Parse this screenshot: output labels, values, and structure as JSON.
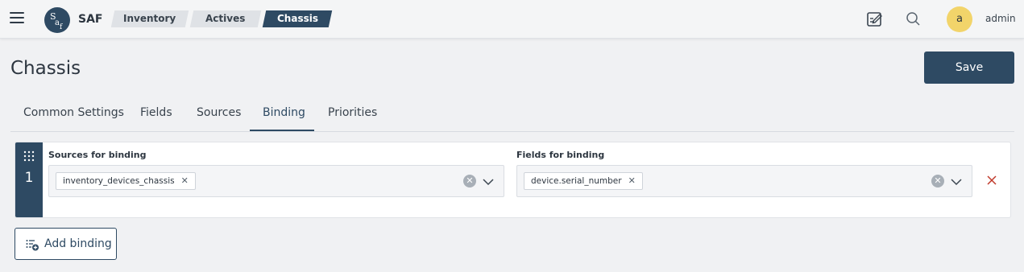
{
  "header": {
    "app_name": "SAF",
    "logo_letters": "Saf",
    "breadcrumbs": [
      "Inventory",
      "Actives",
      "Chassis"
    ],
    "user_initial": "a",
    "user_name": "admin"
  },
  "page": {
    "title": "Chassis",
    "save_label": "Save"
  },
  "tabs": [
    {
      "label": "Common Settings",
      "active": false
    },
    {
      "label": "Fields",
      "active": false
    },
    {
      "label": "Sources",
      "active": false
    },
    {
      "label": "Binding",
      "active": true
    },
    {
      "label": "Priorities",
      "active": false
    }
  ],
  "bindings": [
    {
      "index": "1",
      "sources_label": "Sources for binding",
      "sources": [
        "inventory_devices_chassis"
      ],
      "fields_label": "Fields for binding",
      "fields": [
        "device.serial_number"
      ]
    }
  ],
  "add_binding_label": "Add binding",
  "colors": {
    "primary": "#2e4a63",
    "avatar": "#f2d46a",
    "remove": "#c0392b"
  },
  "icons": [
    "menu-icon",
    "edit-note-icon",
    "search-icon",
    "drag-handle-icon",
    "clear-icon",
    "chevron-down-icon",
    "close-icon",
    "add-list-icon"
  ]
}
